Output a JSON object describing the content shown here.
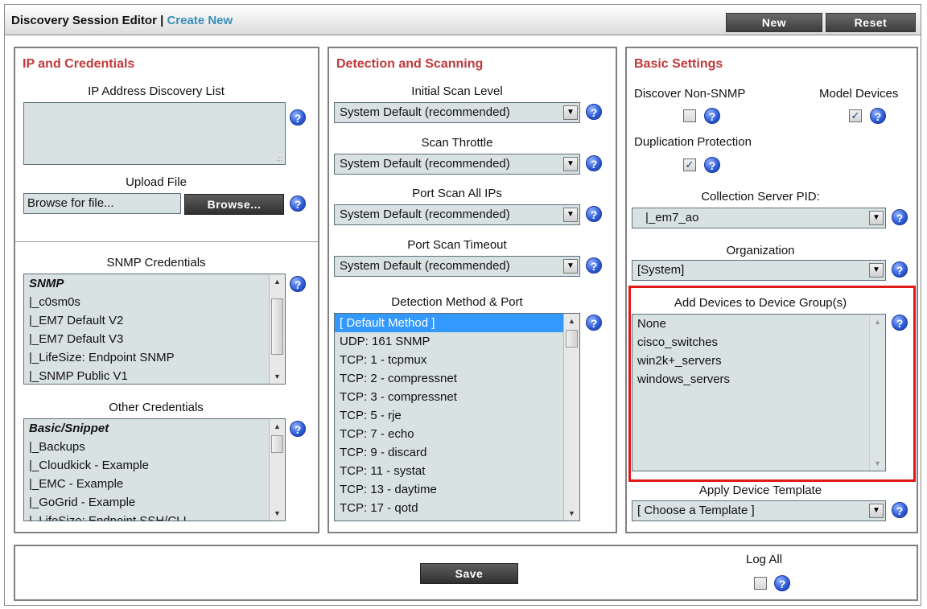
{
  "header": {
    "title": "Discovery Session Editor",
    "separator": "|",
    "subtitle": "Create New",
    "new_button": "New",
    "reset_button": "Reset"
  },
  "ip_panel": {
    "title": "IP and Credentials",
    "ip_list_label": "IP Address Discovery List",
    "ip_list_value": "",
    "upload_label": "Upload File",
    "upload_placeholder": "Browse for file...",
    "browse_button": "Browse...",
    "snmp_label": "SNMP Credentials",
    "snmp_items": [
      "SNMP",
      "|_c0sm0s",
      "|_EM7 Default V2",
      "|_EM7 Default V3",
      "|_LifeSize: Endpoint SNMP",
      "|_SNMP Public V1"
    ],
    "other_label": "Other Credentials",
    "other_items": [
      "Basic/Snippet",
      "|_Backups",
      "|_Cloudkick - Example",
      "|_EMC - Example",
      "|_GoGrid - Example",
      "|_LifeSize: Endpoint SSH/CLI"
    ]
  },
  "detection_panel": {
    "title": "Detection and Scanning",
    "initial_scan_label": "Initial Scan Level",
    "initial_scan_value": "System Default (recommended)",
    "throttle_label": "Scan Throttle",
    "throttle_value": "System Default (recommended)",
    "port_scan_all_label": "Port Scan All IPs",
    "port_scan_all_value": "System Default (recommended)",
    "port_timeout_label": "Port Scan Timeout",
    "port_timeout_value": "System Default (recommended)",
    "method_label": "Detection Method & Port",
    "methods": [
      "[ Default Method ]",
      "UDP: 161 SNMP",
      "TCP: 1 - tcpmux",
      "TCP: 2 - compressnet",
      "TCP: 3 - compressnet",
      "TCP: 5 - rje",
      "TCP: 7 - echo",
      "TCP: 9 - discard",
      "TCP: 11 - systat",
      "TCP: 13 - daytime",
      "TCP: 17 - qotd"
    ]
  },
  "basic_panel": {
    "title": "Basic Settings",
    "non_snmp_label": "Discover Non-SNMP",
    "non_snmp_checked": false,
    "model_devices_label": "Model Devices",
    "model_devices_checked": true,
    "dup_protection_label": "Duplication Protection",
    "dup_protection_checked": true,
    "collection_label": "Collection Server PID:",
    "collection_value": "|_em7_ao",
    "org_label": "Organization",
    "org_value": "[System]",
    "device_group_label": "Add Devices to Device Group(s)",
    "device_groups": [
      "None",
      "cisco_switches",
      "win2k+_servers",
      "windows_servers"
    ],
    "template_label": "Apply Device Template",
    "template_value": "[ Choose a Template ]"
  },
  "footer": {
    "save_button": "Save",
    "log_all_label": "Log All",
    "log_all_checked": false
  },
  "icons": {
    "help": "?",
    "dropdown": "▼",
    "check": "✓"
  }
}
